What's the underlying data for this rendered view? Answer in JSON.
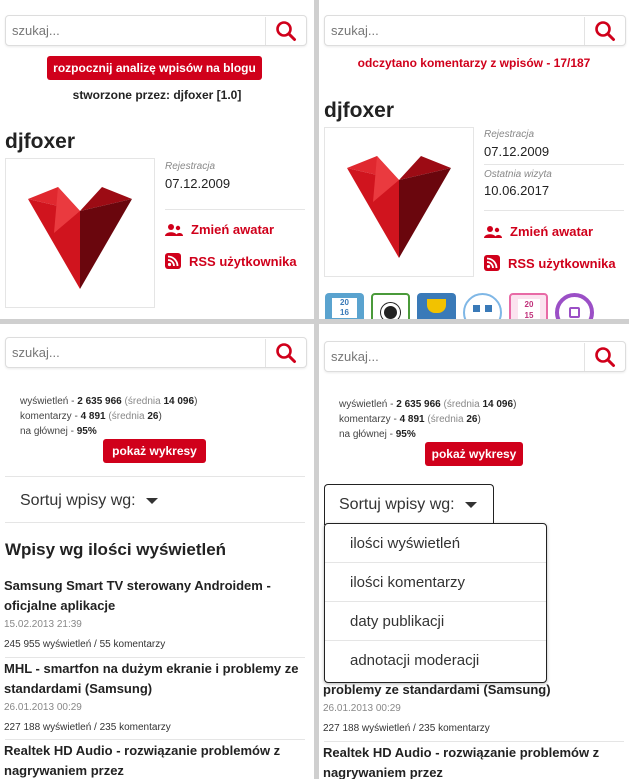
{
  "colors": {
    "accent": "#d0001b",
    "avatar_light": "#d6202a",
    "avatar_mid": "#9c0b14",
    "avatar_dark": "#6a060d"
  },
  "search": {
    "placeholder": "szukaj..."
  },
  "panel1": {
    "analyze_button": "rozpocznij analizę wpisów na blogu",
    "created_by": "stworzone przez: djfoxer [1.0]",
    "username": "djfoxer",
    "registration_label": "Rejestracja",
    "registration_date": "07.12.2009",
    "change_avatar": "Zmień awatar",
    "rss": "RSS użytkownika"
  },
  "panel2": {
    "status": "odczytano komentarzy z wpisów - 17/187",
    "username": "djfoxer",
    "registration_label": "Rejestracja",
    "registration_date": "07.12.2009",
    "last_visit_label": "Ostatnia wizyta",
    "last_visit_date": "10.06.2017",
    "change_avatar": "Zmień awatar",
    "rss": "RSS użytkownika",
    "badges": [
      {
        "icon": "calendar-2016-badge-icon",
        "color": "#5aa3cf",
        "text": "20 16"
      },
      {
        "icon": "football-badge-icon",
        "color": "#4a9a3a",
        "text": ""
      },
      {
        "icon": "trophy-badge-icon",
        "color": "#3a7ab8",
        "text": ""
      },
      {
        "icon": "network-badge-icon",
        "color": "#7fb7e6",
        "text": ""
      },
      {
        "icon": "calendar-2015-badge-icon",
        "color": "#e86aa6",
        "text": "20 15"
      },
      {
        "icon": "purple-ring-badge-icon",
        "color": "#9b4fc6",
        "text": ""
      }
    ]
  },
  "stats": {
    "views_label": "wyświetleń",
    "views": "2 635 966",
    "views_avg_label": "średnia",
    "views_avg": "14 096",
    "comments_label": "komentarzy",
    "comments": "4 891",
    "comments_avg_label": "średnia",
    "comments_avg": "26",
    "main_label": "na głównej",
    "main": "95%"
  },
  "charts_button": "pokaż wykresy",
  "sort_label": "Sortuj wpisy wg:",
  "list_heading": "Wpisy wg ilości wyświetleń",
  "entries": [
    {
      "title": "Samsung Smart TV sterowany Androidem - oficjalne aplikacje",
      "date": "15.02.2013 21:39",
      "views": "245 955 wyświetleń",
      "comments": "55 komentarzy"
    },
    {
      "title": "MHL - smartfon na dużym ekranie i problemy ze standardami (Samsung)",
      "date": "26.01.2013 00:29",
      "views": "227 188 wyświetleń",
      "comments": "235 komentarzy"
    },
    {
      "title": "Realtek HD Audio - rozwiązanie problemów z nagrywaniem przez",
      "date": "",
      "views": "",
      "comments": ""
    }
  ],
  "panel4_entry_fragment": "problemy ze standardami (Samsung)",
  "dropdown": {
    "options": [
      "ilości wyświetleń",
      "ilości komentarzy",
      "daty publikacji",
      "adnotacji moderacji"
    ]
  }
}
